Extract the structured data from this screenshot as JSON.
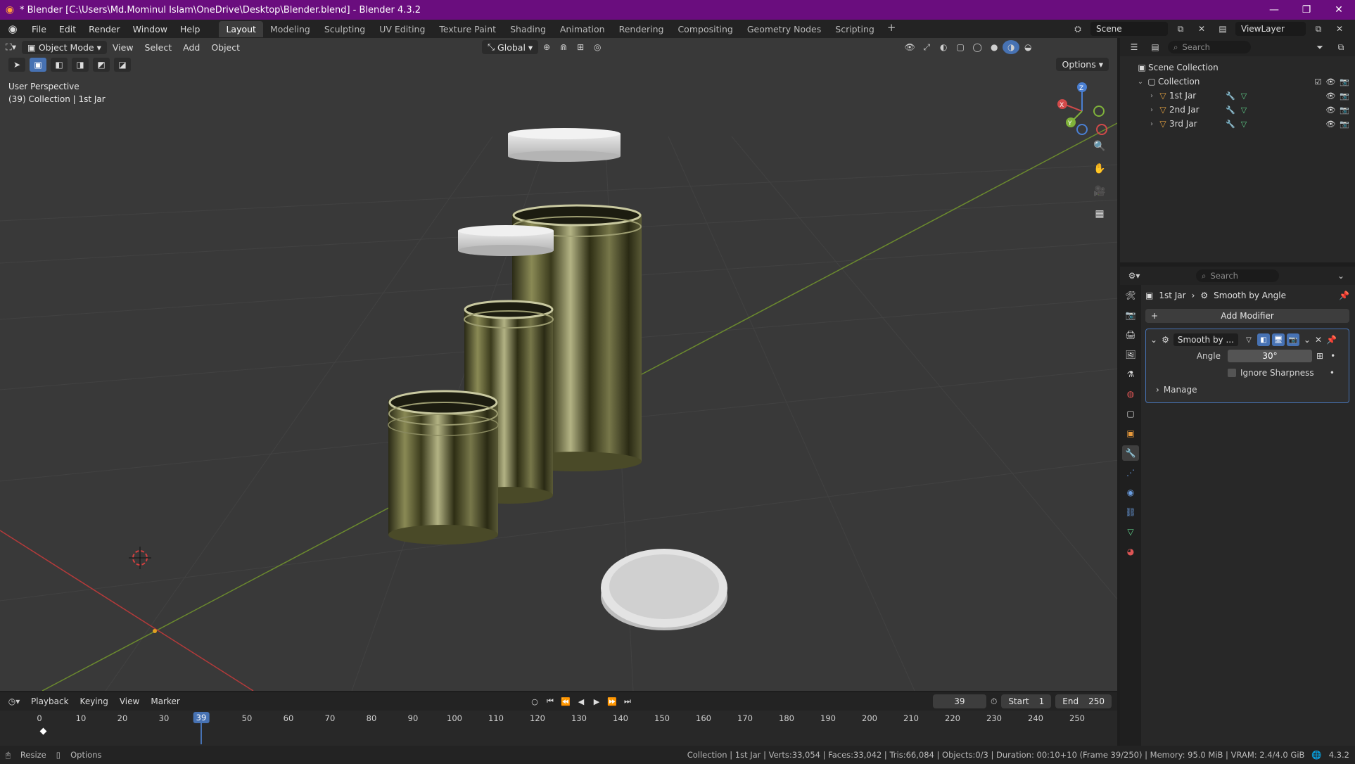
{
  "window": {
    "title": "* Blender [C:\\Users\\Md.Mominul Islam\\OneDrive\\Desktop\\Blender.blend] - Blender 4.3.2",
    "controls": [
      "—",
      "❐",
      "✕"
    ]
  },
  "menu": {
    "items": [
      "File",
      "Edit",
      "Render",
      "Window",
      "Help"
    ]
  },
  "workspaces": {
    "tabs": [
      "Layout",
      "Modeling",
      "Sculpting",
      "UV Editing",
      "Texture Paint",
      "Shading",
      "Animation",
      "Rendering",
      "Compositing",
      "Geometry Nodes",
      "Scripting"
    ],
    "active": "Layout",
    "add": "+"
  },
  "scene_selector": {
    "scene": "Scene",
    "view_layer": "ViewLayer"
  },
  "viewport": {
    "mode": "Object Mode",
    "menus": [
      "View",
      "Select",
      "Add",
      "Object"
    ],
    "transform": "Global",
    "options": "Options",
    "info_line1": "User Perspective",
    "info_line2": "(39) Collection | 1st Jar",
    "gizmo": {
      "x": "X",
      "y": "Y",
      "z": "Z"
    }
  },
  "outliner": {
    "search_placeholder": "Search",
    "scene_collection": "Scene Collection",
    "collection": "Collection",
    "objects": [
      "1st Jar",
      "2nd Jar",
      "3rd Jar"
    ]
  },
  "properties": {
    "search_placeholder": "Search",
    "breadcrumb_object": "1st Jar",
    "breadcrumb_modifier": "Smooth by Angle",
    "add_modifier": "Add Modifier",
    "modifier": {
      "name": "Smooth by ...",
      "angle_label": "Angle",
      "angle_value": "30°",
      "ignore_sharpness": "Ignore Sharpness",
      "manage": "Manage"
    }
  },
  "timeline": {
    "menus": [
      "Playback",
      "Keying",
      "View",
      "Marker"
    ],
    "current_frame": "39",
    "start_label": "Start",
    "start": "1",
    "end_label": "End",
    "end": "250",
    "ticks": [
      "0",
      "10",
      "20",
      "30",
      "50",
      "60",
      "70",
      "80",
      "90",
      "100",
      "110",
      "120",
      "130",
      "140",
      "150",
      "160",
      "170",
      "180",
      "190",
      "200",
      "210",
      "220",
      "230",
      "240",
      "250"
    ]
  },
  "statusbar": {
    "resize": "Resize",
    "options": "Options",
    "info": "Collection | 1st Jar | Verts:33,054 | Faces:33,042 | Tris:66,084 | Objects:0/3 | Duration: 00:10+10 (Frame 39/250) | Memory: 95.0 MiB | VRAM: 2.4/4.0 GiB",
    "version": "4.3.2"
  },
  "colors": {
    "titlebar": "#6a0d7e",
    "accent": "#4772b3",
    "viewport_bg": "#393939",
    "x_axis": "#d24a4a",
    "y_axis": "#7fb23a",
    "z_axis": "#4a7fd2"
  }
}
